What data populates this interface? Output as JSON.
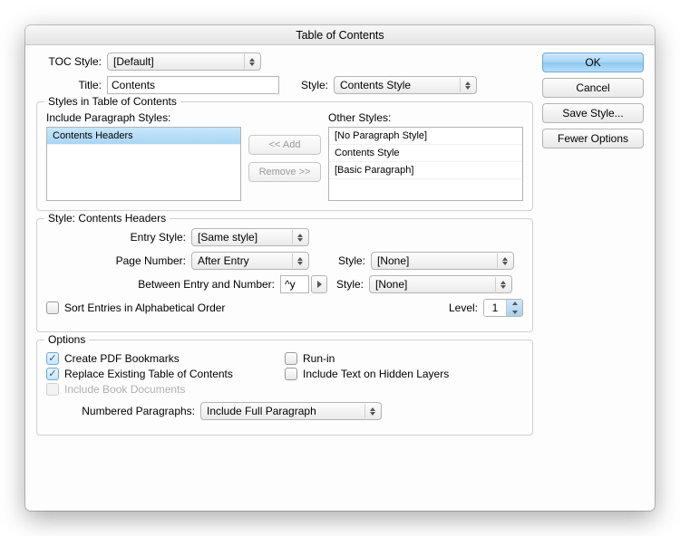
{
  "window": {
    "title": "Table of Contents"
  },
  "buttons": {
    "ok": "OK",
    "cancel": "Cancel",
    "save_style": "Save Style...",
    "fewer_options": "Fewer Options"
  },
  "top": {
    "toc_style_label": "TOC Style:",
    "toc_style_value": "[Default]",
    "title_label": "Title:",
    "title_value": "Contents",
    "style_label": "Style:",
    "style_value": "Contents Style"
  },
  "styles_group": {
    "legend": "Styles in Table of Contents",
    "include_label": "Include Paragraph Styles:",
    "other_label": "Other Styles:",
    "include_items": [
      "Contents Headers"
    ],
    "other_items": [
      "[No Paragraph Style]",
      "Contents Style",
      "[Basic Paragraph]"
    ],
    "add_btn": "<< Add",
    "remove_btn": "Remove >>"
  },
  "style_detail": {
    "legend": "Style: Contents Headers",
    "entry_style_label": "Entry Style:",
    "entry_style_value": "[Same style]",
    "page_number_label": "Page Number:",
    "page_number_value": "After Entry",
    "page_number_style_label": "Style:",
    "page_number_style_value": "[None]",
    "between_label": "Between Entry and Number:",
    "between_value": "^y",
    "between_style_label": "Style:",
    "between_style_value": "[None]",
    "sort_label": "Sort Entries in Alphabetical Order",
    "level_label": "Level:",
    "level_value": "1"
  },
  "options": {
    "legend": "Options",
    "create_pdf": "Create PDF Bookmarks",
    "replace_existing": "Replace Existing Table of Contents",
    "include_book": "Include Book Documents",
    "run_in": "Run-in",
    "include_hidden": "Include Text on Hidden Layers",
    "numbered_label": "Numbered Paragraphs:",
    "numbered_value": "Include Full Paragraph"
  }
}
